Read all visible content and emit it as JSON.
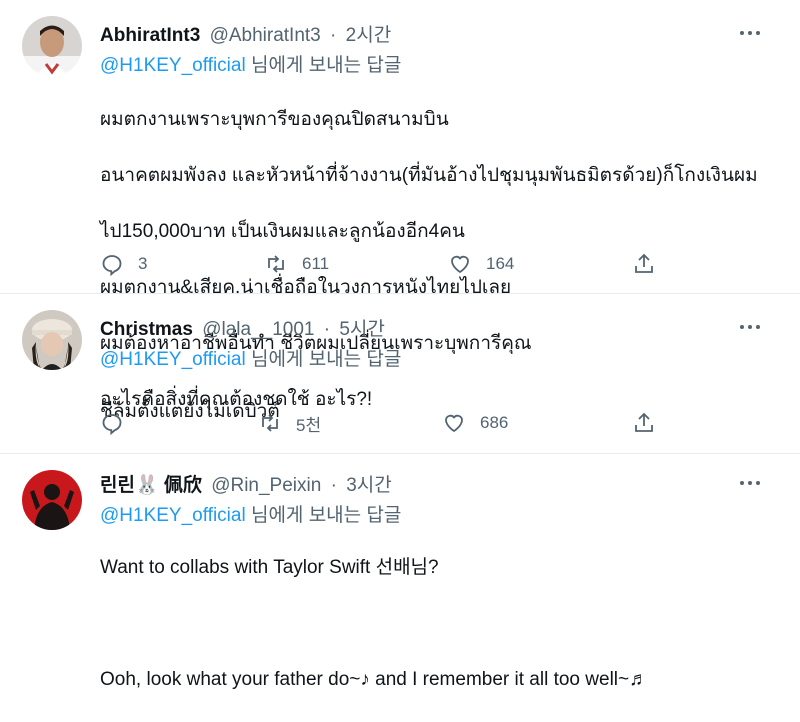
{
  "tweets": [
    {
      "name": "AbhiratInt3",
      "handle": "@AbhiratInt3",
      "time": "2시간",
      "mention": "@H1KEY_official",
      "reply_suffix": "님에게 보내는 답글",
      "lines": [
        "ผมตกงานเพราะบุพการีของคุณปิดสนามบิน",
        "อนาคตผมพังลง และหัวหน้าที่จ้างงาน(ที่มันอ้างไปชุมนุมพันธมิตรด้วย)ก็โกงเงินผม",
        "ไป150,000บาท เป็นเงินผมและลูกน้องอีก4คน",
        "ผมตกงาน&เสียค.น่าเชื่อถือในวงการหนังไทยไปเลย",
        "ผมต้องหาอาชีพอื่นทำ ชีวิตผมเปลี่ยนเพราะบุพการีคุณ",
        "อะไรคือสิ่งที่คุณต้องชดใช้ อะไร?!"
      ],
      "replies": "3",
      "retweets": "611",
      "likes": "164"
    },
    {
      "name": "Christmas",
      "handle": "@lala__1001",
      "time": "5시간",
      "mention": "@H1KEY_official",
      "reply_suffix": "님에게 보내는 답글",
      "lines": [
        "ชีล้มตั้งแต่ยังไม่เดบิวต์"
      ],
      "replies": "",
      "retweets": "5천",
      "likes": "686"
    },
    {
      "name": "린린🐰 佩欣",
      "handle": "@Rin_Peixin",
      "time": "3시간",
      "mention": "@H1KEY_official",
      "reply_suffix": "님에게 보내는 답글",
      "lines": [
        "Want to collabs with Taylor Swift 선배님?",
        "",
        "Ooh, look what your father do~♪ and I remember it all too well~♬"
      ]
    }
  ],
  "icons": {
    "reply": "reply-icon",
    "retweet": "retweet-icon",
    "like": "heart-icon",
    "share": "share-icon",
    "more": "more-icon"
  },
  "colors": {
    "link": "#1d9bf0",
    "muted": "#536471",
    "text": "#0f1419",
    "divider": "#e6ecf0"
  }
}
